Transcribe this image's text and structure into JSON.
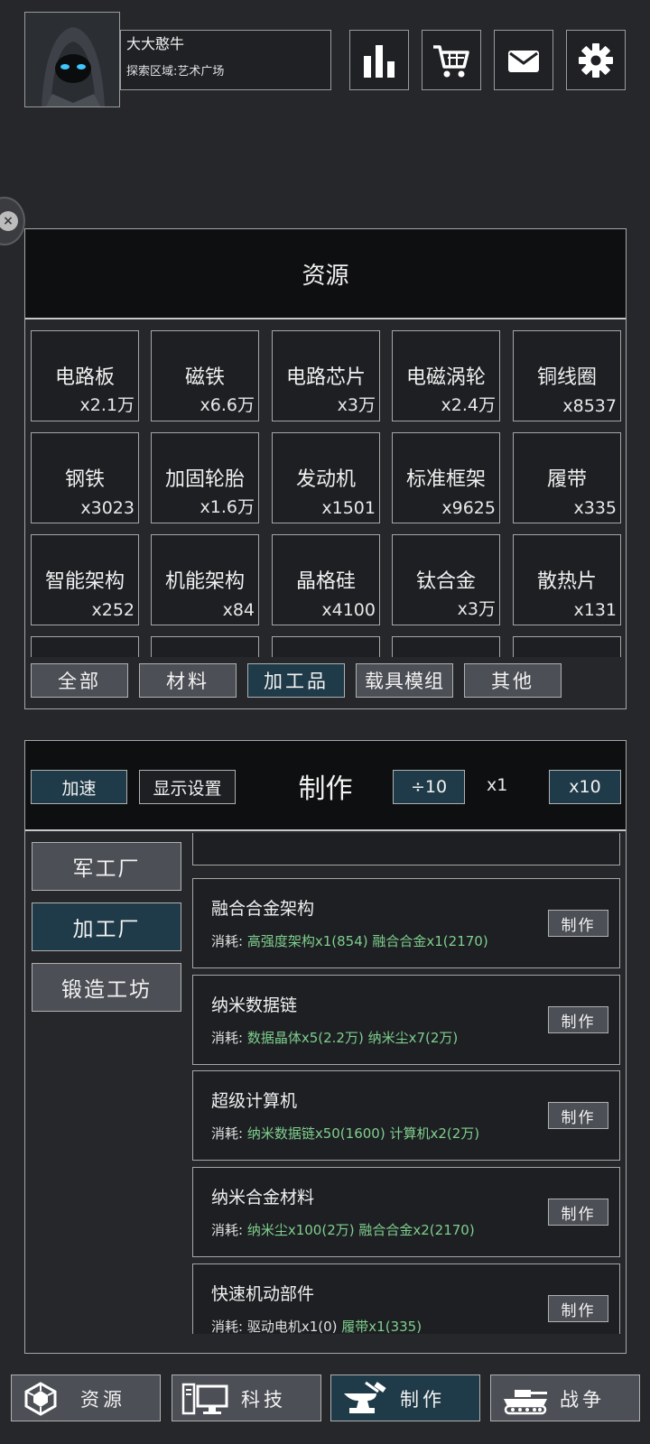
{
  "header": {
    "username": "大大憨牛",
    "area": "探索区域:艺术广场",
    "buttons": [
      {
        "icon": "bar-chart-icon"
      },
      {
        "icon": "shopping-cart-icon"
      },
      {
        "icon": "mail-icon"
      },
      {
        "icon": "gear-icon"
      }
    ]
  },
  "resources": {
    "title": "资源",
    "items": [
      {
        "name": "电路板",
        "count": "x2.1万"
      },
      {
        "name": "磁铁",
        "count": "x6.6万"
      },
      {
        "name": "电路芯片",
        "count": "x3万"
      },
      {
        "name": "电磁涡轮",
        "count": "x2.4万"
      },
      {
        "name": "铜线圈",
        "count": "x8537"
      },
      {
        "name": "钢铁",
        "count": "x3023"
      },
      {
        "name": "加固轮胎",
        "count": "x1.6万"
      },
      {
        "name": "发动机",
        "count": "x1501"
      },
      {
        "name": "标准框架",
        "count": "x9625"
      },
      {
        "name": "履带",
        "count": "x335"
      },
      {
        "name": "智能架构",
        "count": "x252"
      },
      {
        "name": "机能架构",
        "count": "x84"
      },
      {
        "name": "晶格硅",
        "count": "x4100"
      },
      {
        "name": "钛合金",
        "count": "x3万"
      },
      {
        "name": "散热片",
        "count": "x131"
      }
    ],
    "filters": [
      {
        "label": "全部",
        "active": false
      },
      {
        "label": "材料",
        "active": false
      },
      {
        "label": "加工品",
        "active": true
      },
      {
        "label": "载具模组",
        "active": false
      },
      {
        "label": "其他",
        "active": false
      }
    ]
  },
  "craft": {
    "title": "制作",
    "speed_label": "加速",
    "display_settings_label": "显示设置",
    "div10_label": "÷10",
    "multiplier": "x1",
    "x10_label": "x10",
    "factories": [
      {
        "label": "军工厂",
        "active": false
      },
      {
        "label": "加工厂",
        "active": true
      },
      {
        "label": "锻造工坊",
        "active": false
      }
    ],
    "cost_prefix": "消耗:",
    "make_label": "制作",
    "recipes": [
      {
        "name": "融合合金架构",
        "costs": [
          "高强度架构x1(854)",
          "融合合金x1(2170)"
        ],
        "cost_color": "green"
      },
      {
        "name": "纳米数据链",
        "costs": [
          "数据晶体x5(2.2万)",
          "纳米尘x7(2万)"
        ],
        "cost_color": "green"
      },
      {
        "name": "超级计算机",
        "costs": [
          "纳米数据链x50(1600)",
          "计算机x2(2万)"
        ],
        "cost_color": "green"
      },
      {
        "name": "纳米合金材料",
        "costs": [
          "纳米尘x100(2万)",
          "融合合金x2(2170)"
        ],
        "cost_color": "green"
      },
      {
        "name": "快速机动部件",
        "costs": [
          "驱动电机x1(0)",
          "履带x1(335)"
        ],
        "cost_color": "mixed"
      }
    ]
  },
  "nav": [
    {
      "label": "资源",
      "icon": "resource-icon",
      "active": false
    },
    {
      "label": "科技",
      "icon": "computer-icon",
      "active": false
    },
    {
      "label": "制作",
      "icon": "anvil-icon",
      "active": true
    },
    {
      "label": "战争",
      "icon": "tank-icon",
      "active": false
    }
  ],
  "colors": {
    "background": "#25272a",
    "panel_dark": "#0e0f10",
    "button_gray": "#4c4f55",
    "button_active": "#1f3a48",
    "cost_green": "#7fcf8e"
  }
}
